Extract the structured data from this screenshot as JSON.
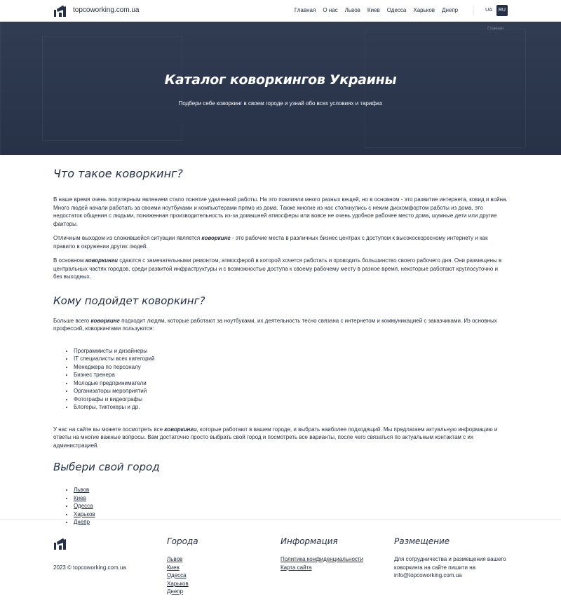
{
  "site": {
    "name": "topcoworking.com.ua"
  },
  "nav": {
    "items": [
      "Главная",
      "О нас",
      "Львов",
      "Киев",
      "Одесса",
      "Харьков",
      "Днепр"
    ],
    "lang": [
      "UA",
      "RU"
    ],
    "active_lang": "RU"
  },
  "hero": {
    "link": "Главная",
    "title": "Каталог коворкингов Украины",
    "subtitle": "Подбери себе коворкинг в своем городе и узнай обо всех условиях и тарифах"
  },
  "what": {
    "heading": "Что такое коворкинг?",
    "p1": "В наше время очень популярным явлением стало понятие удаленной работы. На это повлияли много разных вещей, но в основном - это развитие интернета, ковид и война. Много людей начали работать за своими ноутбуками и компьютерами прямо из дома. Также многие из нас столкнулись с неким дискомфортом работы из дома, это недостаток общения с людьми, пониженная производительность из-за домашней атмосферы или вовсе не очень удобное рабочее место дома, шумные дети или другие факторы.",
    "p2_a": "Отличным выходом из сложившейся ситуации является ",
    "p2_b": "коворкинг",
    "p2_c": " - это рабочие места в различных бизнес центрах с доступом к высокоскоросному интернету и как правило в окружении других людей.",
    "p3_a": "В основном ",
    "p3_b": "коворкинги",
    "p3_c": " сдаются с замечательными ремонтом, атмосферой в которой хочется работать и проводить большинство своего рабочего дня. Они размещены в центральных частях городов, среди развитой инфраструктуры и с возможностью доступа к своему рабочему месту в разное время, некоторые работают круглосуточно и без выходных."
  },
  "who": {
    "heading": "Кому подойдет коворкинг?",
    "p1_a": "Больше всего ",
    "p1_b": "коворкинг",
    "p1_c": " подходит людям, которые работают за ноутбуками, их деятельность тесно связана с интернетом и коммуникацией с заказчиками. Из основных профессий, коворкингами пользуются:",
    "items": [
      "Программисты и дизайнеры",
      "IT специалисты всех категорий",
      "Менеджера по персоналу",
      "Бизнес тренера",
      "Молодые предприниматели",
      "Организаторы мероприятий",
      "Фотографы и видеографы",
      "Блогеры, тиктокеры и др."
    ],
    "p2_a": "У нас на сайте вы можете посмотреть все ",
    "p2_b": "коворкинги",
    "p2_c": ", которые работают в вашем городе, и выбрать наиболее подходящий. Мы предлагаем актуальную информацию и ответы на многие важные вопросы. Вам достаточно просто выбрать свой город и посмотреть все варианты, после чего связаться по актуальным контактам с их администрацией."
  },
  "cities": {
    "heading": "Выбери свой город",
    "items": [
      "Львов",
      "Киев",
      "Одесса",
      "Харьков",
      "Днепр"
    ]
  },
  "footer": {
    "copyright": "2023 © topcoworking.com.ua",
    "cities_heading": "Города",
    "cities": [
      "Львов",
      "Киев",
      "Одесса",
      "Харьков",
      "Днепр"
    ],
    "info_heading": "Информация",
    "info_links": [
      "Политика конфиденциальности",
      "Карта сайта"
    ],
    "placement_heading": "Размещение",
    "placement_text": "Для сотрудничества и размещения вашего коворкинга на сайте пишити на info@topcoworking.com.ua"
  }
}
